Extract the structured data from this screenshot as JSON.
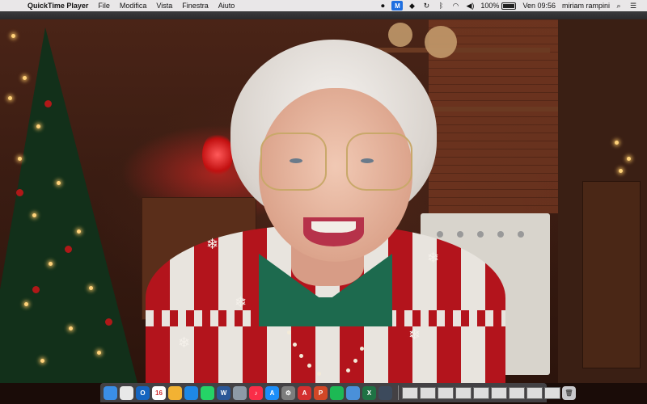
{
  "menubar": {
    "apple_icon": "apple-icon",
    "app_name": "QuickTime Player",
    "menus": [
      "File",
      "Modifica",
      "Vista",
      "Finestra",
      "Aiuto"
    ],
    "status": {
      "battery_percent": "100%",
      "clock": "Ven 09:56",
      "user": "miriam rampini",
      "icons": [
        "record-icon",
        "maltego-icon",
        "dropbox-icon",
        "time-machine-icon",
        "bluetooth-icon",
        "wifi-icon",
        "volume-icon",
        "battery-icon",
        "search-icon",
        "list-icon"
      ]
    }
  },
  "video": {
    "description_icons": [
      "christmas-tree",
      "woman-portrait"
    ]
  },
  "dock": {
    "apps": [
      {
        "name": "finder-icon",
        "color": "#3a8ee6",
        "label": ""
      },
      {
        "name": "chrome-icon",
        "color": "#e8e8e8",
        "label": ""
      },
      {
        "name": "outlook-icon",
        "color": "#1565c0",
        "label": "O"
      },
      {
        "name": "calendar-icon",
        "color": "#ffffff",
        "label": "16"
      },
      {
        "name": "photos-icon",
        "color": "#f2b233",
        "label": ""
      },
      {
        "name": "safari-icon",
        "color": "#1e88e5",
        "label": ""
      },
      {
        "name": "whatsapp-icon",
        "color": "#25d366",
        "label": ""
      },
      {
        "name": "word-icon",
        "color": "#2b5797",
        "label": "W"
      },
      {
        "name": "preview-icon",
        "color": "#8d9aa6",
        "label": ""
      },
      {
        "name": "music-icon",
        "color": "#fa2d48",
        "label": "♪"
      },
      {
        "name": "appstore-icon",
        "color": "#1c8ef9",
        "label": "A"
      },
      {
        "name": "settings-icon",
        "color": "#7d7d7d",
        "label": "⚙"
      },
      {
        "name": "acrobat-icon",
        "color": "#d32f2f",
        "label": "A"
      },
      {
        "name": "powerpoint-icon",
        "color": "#d24726",
        "label": "P"
      },
      {
        "name": "spotify-icon",
        "color": "#1db954",
        "label": ""
      },
      {
        "name": "keynote-icon",
        "color": "#4a90d9",
        "label": ""
      },
      {
        "name": "excel-icon",
        "color": "#1f7244",
        "label": "X"
      },
      {
        "name": "quicktime-icon",
        "color": "#3c4a5c",
        "label": ""
      }
    ],
    "thumbs": 9,
    "trash_icon": "trash-icon"
  }
}
